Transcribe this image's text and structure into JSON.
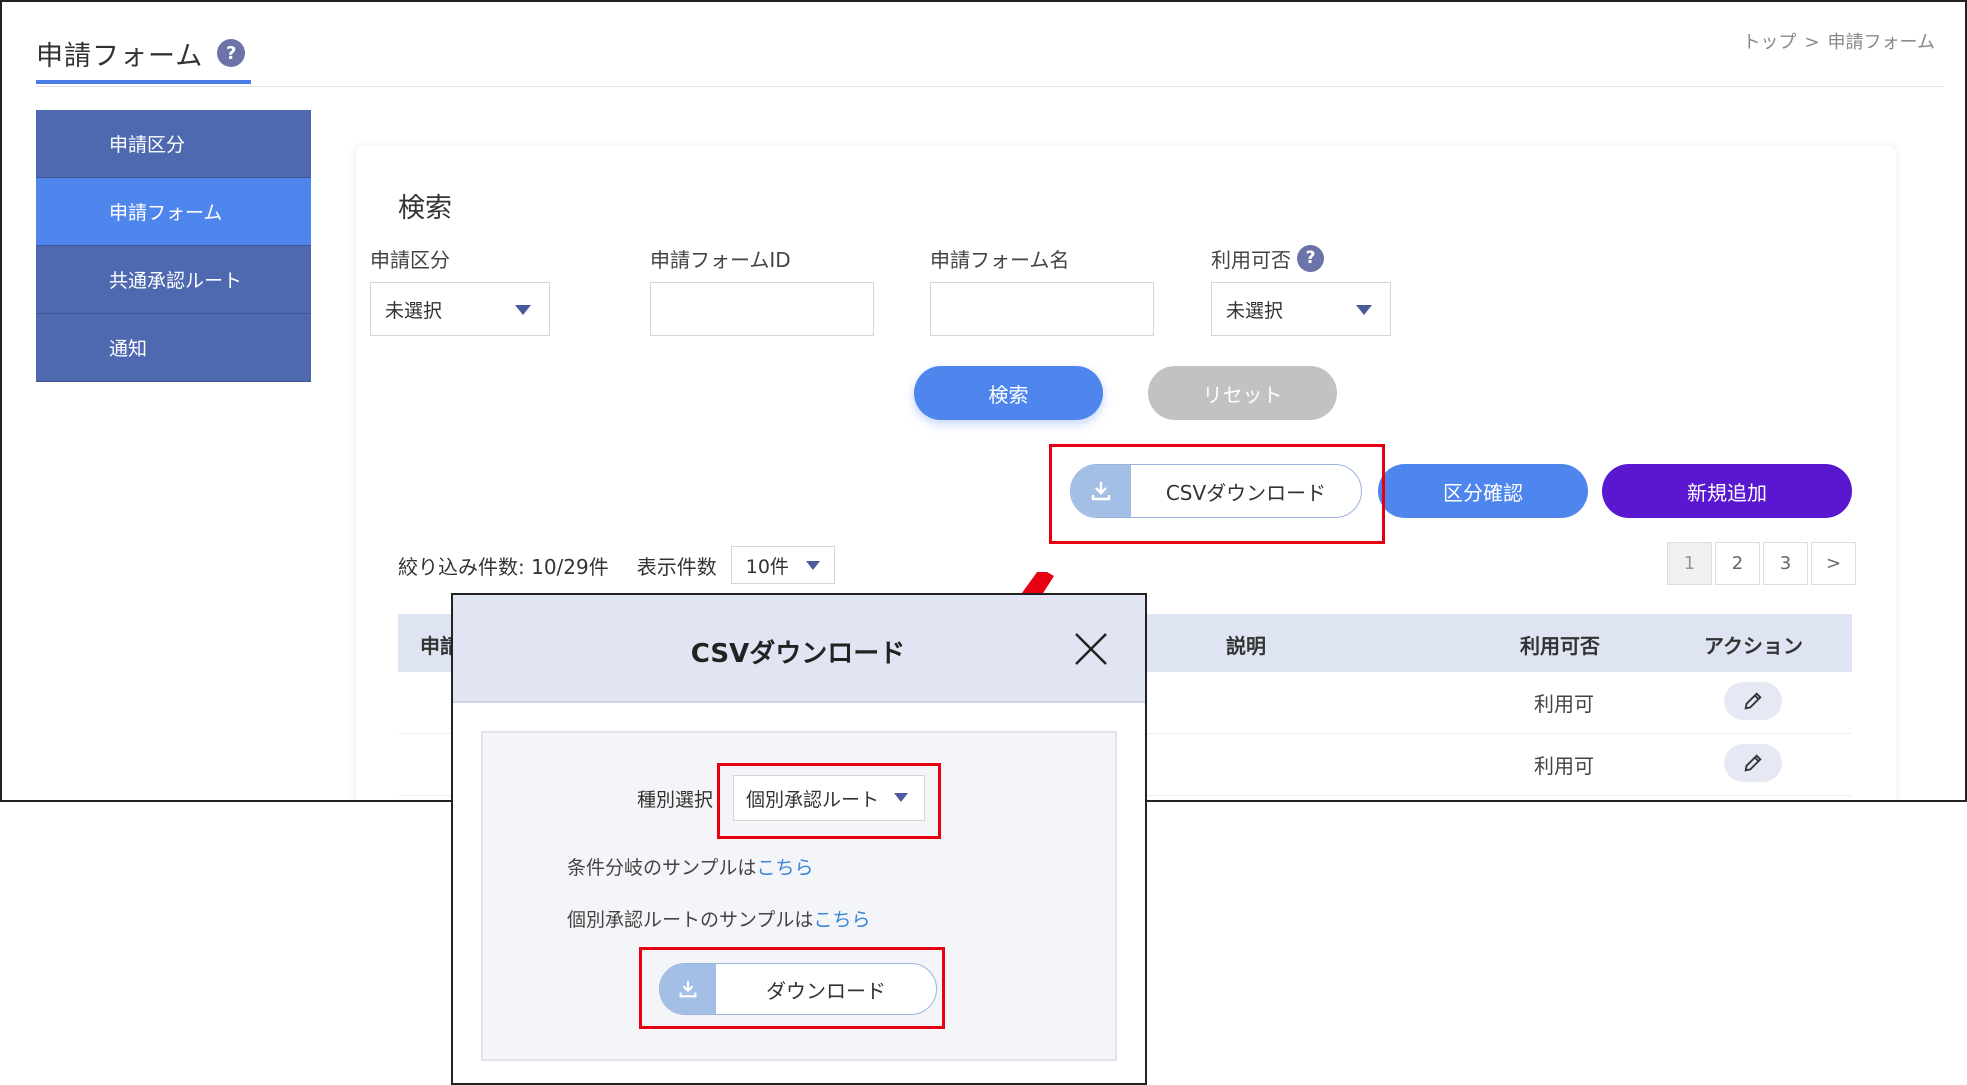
{
  "page": {
    "title": "申請フォーム",
    "help": "?",
    "breadcrumb": [
      "トップ",
      ">",
      "申請フォーム"
    ]
  },
  "sidebar": {
    "items": [
      {
        "label": "申請区分"
      },
      {
        "label": "申請フォーム"
      },
      {
        "label": "共通承認ルート"
      },
      {
        "label": "通知"
      }
    ]
  },
  "search": {
    "title": "検索",
    "fields": {
      "category": {
        "label": "申請区分",
        "value": "未選択"
      },
      "form_id": {
        "label": "申請フォームID",
        "value": ""
      },
      "form_name": {
        "label": "申請フォーム名",
        "value": ""
      },
      "availability": {
        "label": "利用可否",
        "value": "未選択",
        "help": "?"
      }
    },
    "search_button": "検索",
    "reset_button": "リセット"
  },
  "actions": {
    "csv_download": "CSVダウンロード",
    "category_check": "区分確認",
    "add_new": "新規追加"
  },
  "listing": {
    "filtered_count": "絞り込み件数: 10/29件",
    "per_page_label": "表示件数",
    "per_page_value": "10件",
    "pages": [
      "1",
      "2",
      "3",
      ">"
    ]
  },
  "table": {
    "headers": {
      "first": "申請",
      "description": "説明",
      "availability": "利用可否",
      "action": "アクション"
    },
    "rows": [
      {
        "availability": "利用可"
      },
      {
        "availability": "利用可"
      }
    ]
  },
  "modal": {
    "title": "CSVダウンロード",
    "kind_label": "種別選択",
    "kind_value": "個別承認ルート",
    "sample1_text": "条件分岐のサンプルは",
    "sample1_link": "こちら",
    "sample2_text": "個別承認ルートのサンプルは",
    "sample2_link": "こちら",
    "download_button": "ダウンロード"
  },
  "colors": {
    "primary": "#4f86ee",
    "sidebar": "#4e69b0",
    "new_button": "#5a17d0",
    "highlight": "#e60012"
  }
}
